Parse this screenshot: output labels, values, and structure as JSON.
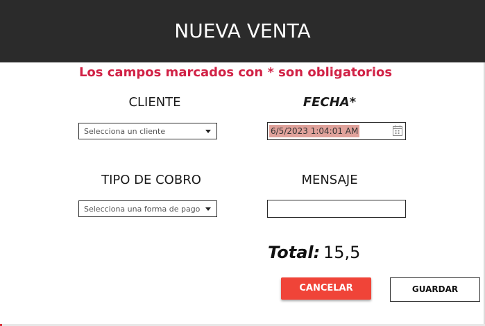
{
  "header": {
    "title": "NUEVA VENTA"
  },
  "notice": "Los campos marcados con * son obligatorios",
  "form": {
    "cliente": {
      "label": "CLIENTE",
      "placeholder": "Selecciona un cliente"
    },
    "fecha": {
      "label": "FECHA*",
      "value": "6/5/2023 1:04:01 AM"
    },
    "tipo_cobro": {
      "label": "TIPO DE COBRO",
      "placeholder": "Selecciona una forma de pago"
    },
    "mensaje": {
      "label": "MENSAJE",
      "value": ""
    }
  },
  "total": {
    "label": "Total:",
    "value": "15,5"
  },
  "buttons": {
    "cancel": "CANCELAR",
    "save": "GUARDAR"
  },
  "colors": {
    "header_bg": "#2b2b2b",
    "notice": "#d12246",
    "cancel_bg": "#f04438",
    "date_highlight": "#e0a29b"
  },
  "icons": {
    "date_picker": "calendar-icon",
    "dropdown": "chevron-down-icon"
  }
}
